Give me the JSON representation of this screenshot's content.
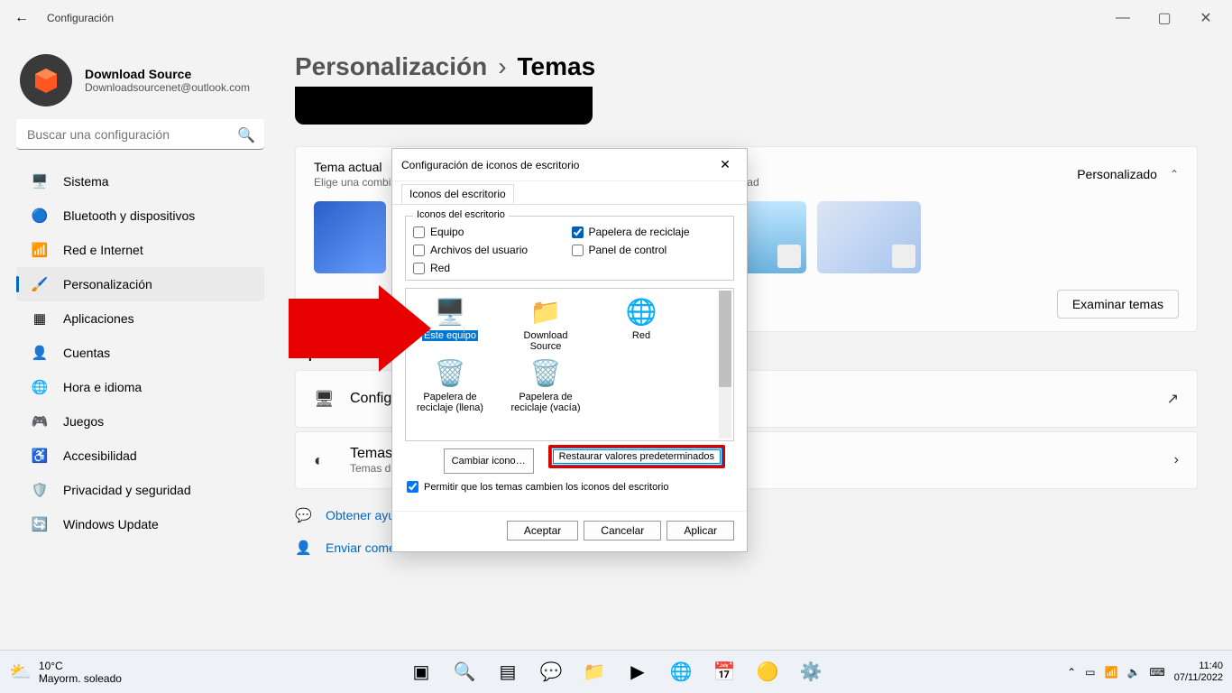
{
  "window": {
    "title": "Configuración"
  },
  "user": {
    "name": "Download Source",
    "email": "Downloadsourcenet@outlook.com"
  },
  "search": {
    "placeholder": "Buscar una configuración"
  },
  "nav": [
    {
      "label": "Sistema",
      "icon": "🖥️"
    },
    {
      "label": "Bluetooth y dispositivos",
      "icon": "🔵"
    },
    {
      "label": "Red e Internet",
      "icon": "📶"
    },
    {
      "label": "Personalización",
      "icon": "🖌️",
      "active": true
    },
    {
      "label": "Aplicaciones",
      "icon": "▦"
    },
    {
      "label": "Cuentas",
      "icon": "👤"
    },
    {
      "label": "Hora e idioma",
      "icon": "🌐"
    },
    {
      "label": "Juegos",
      "icon": "🎮"
    },
    {
      "label": "Accesibilidad",
      "icon": "♿"
    },
    {
      "label": "Privacidad y seguridad",
      "icon": "🛡️"
    },
    {
      "label": "Windows Update",
      "icon": "🔄"
    }
  ],
  "breadcrumb": {
    "parent": "Personalización",
    "current": "Temas"
  },
  "themeCard": {
    "title": "Tema actual",
    "subtitle": "Elige una combinación de fondos de pantalla, sonidos y colores para darle más personalidad",
    "right": "Personalizado",
    "button": "Examinar temas"
  },
  "optionsTitle": "Opciones de contenido relacionado",
  "rows": [
    {
      "icon": "🖥",
      "title": "Configuración de iconos de escritorio"
    },
    {
      "icon": "◐",
      "title": "Temas de contraste",
      "sub": "Temas de color para baja visión, sensibilidad a la luz"
    }
  ],
  "links": [
    {
      "icon": "💬",
      "label": "Obtener ayuda"
    },
    {
      "icon": "👤",
      "label": "Enviar comentarios"
    }
  ],
  "dialog": {
    "title": "Configuración de iconos de escritorio",
    "tab": "Iconos del escritorio",
    "groupTitle": "Iconos del escritorio",
    "checks": [
      {
        "label": "Equipo",
        "checked": false
      },
      {
        "label": "Papelera de reciclaje",
        "checked": true
      },
      {
        "label": "Archivos del usuario",
        "checked": false
      },
      {
        "label": "Panel de control",
        "checked": false
      },
      {
        "label": "Red",
        "checked": false
      }
    ],
    "icons": [
      {
        "label": "Este equipo",
        "emoji": "🖥️",
        "selected": true
      },
      {
        "label": "Download Source",
        "emoji": "📁"
      },
      {
        "label": "Red",
        "emoji": "🌐"
      },
      {
        "label": "Papelera de reciclaje (llena)",
        "emoji": "🗑️"
      },
      {
        "label": "Papelera de reciclaje (vacía)",
        "emoji": "🗑️"
      }
    ],
    "changeBtn": "Cambiar icono…",
    "restoreBtn": "Restaurar valores predeterminados",
    "permit": "Permitir que los temas cambien los iconos del escritorio",
    "ok": "Aceptar",
    "cancel": "Cancelar",
    "apply": "Aplicar"
  },
  "taskbar": {
    "temp": "10°C",
    "cond": "Mayorm. soleado",
    "time": "11:40",
    "date": "07/11/2022"
  }
}
